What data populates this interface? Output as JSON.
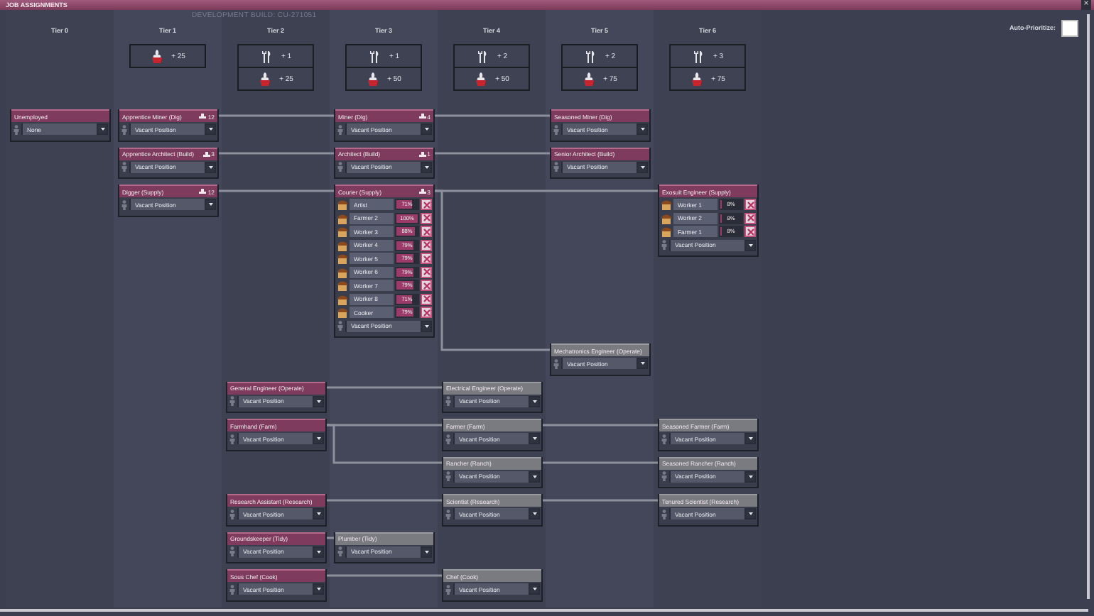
{
  "window": {
    "title": "JOB ASSIGNMENTS",
    "close_glyph": "×"
  },
  "build_label": "DEVELOPMENT BUILD: CU-271051",
  "auto_prioritize": {
    "label": "Auto-Prioritize:",
    "checked": false
  },
  "tiers": [
    {
      "label": "Tier 0"
    },
    {
      "label": "Tier 1",
      "bonuses": [
        {
          "kind": "plant",
          "text": "+ 25"
        }
      ]
    },
    {
      "label": "Tier 2",
      "bonuses": [
        {
          "kind": "tools",
          "text": "+ 1"
        },
        {
          "kind": "plant",
          "text": "+ 25"
        }
      ]
    },
    {
      "label": "Tier 3",
      "bonuses": [
        {
          "kind": "tools",
          "text": "+ 1"
        },
        {
          "kind": "plant",
          "text": "+ 50"
        }
      ]
    },
    {
      "label": "Tier 4",
      "bonuses": [
        {
          "kind": "tools",
          "text": "+ 2"
        },
        {
          "kind": "plant",
          "text": "+ 50"
        }
      ]
    },
    {
      "label": "Tier 5",
      "bonuses": [
        {
          "kind": "tools",
          "text": "+ 2"
        },
        {
          "kind": "plant",
          "text": "+ 75"
        }
      ]
    },
    {
      "label": "Tier 6",
      "bonuses": [
        {
          "kind": "tools",
          "text": "+ 3"
        },
        {
          "kind": "plant",
          "text": "+ 75"
        }
      ]
    }
  ],
  "rows": [
    {
      "tier_0": {
        "title": "Unemployed",
        "unlocked": true,
        "assignment": "None"
      },
      "tier_1": {
        "title": "Apprentice Miner (Dig)",
        "unlocked": true,
        "count": "12",
        "assignment": "Vacant Position"
      },
      "tier_3": {
        "title": "Miner (Dig)",
        "unlocked": true,
        "count": "4",
        "linked": true,
        "assignment": "Vacant Position"
      },
      "tier_5": {
        "title": "Seasoned Miner (Dig)",
        "unlocked": true,
        "linked": true,
        "assignment": "Vacant Position"
      }
    },
    {
      "tier_1": {
        "title": "Apprentice Architect (Build)",
        "unlocked": true,
        "count": "3",
        "assignment": "Vacant Position"
      },
      "tier_3": {
        "title": "Architect (Build)",
        "unlocked": true,
        "count": "1",
        "linked": true,
        "assignment": "Vacant Position"
      },
      "tier_5": {
        "title": "Senior Architect (Build)",
        "unlocked": true,
        "linked": true,
        "assignment": "Vacant Position"
      }
    },
    {
      "tier_1": {
        "title": "Digger (Supply)",
        "unlocked": true,
        "count": "12",
        "assignment": "Vacant Position"
      },
      "tier_3": {
        "title": "Courier (Supply)",
        "unlocked": true,
        "count": "3",
        "linked": true,
        "assignment": "Vacant Position",
        "workers": [
          {
            "name": "Artist",
            "percent": "71%",
            "level": 0.71
          },
          {
            "name": "Farmer 2",
            "percent": "100%",
            "level": 1
          },
          {
            "name": "Worker 3",
            "percent": "88%",
            "level": 0.88
          },
          {
            "name": "Worker 4",
            "percent": "79%",
            "level": 0.79
          },
          {
            "name": "Worker 5",
            "percent": "79%",
            "level": 0.79
          },
          {
            "name": "Worker 6",
            "percent": "79%",
            "level": 0.79
          },
          {
            "name": "Worker 7",
            "percent": "79%",
            "level": 0.79
          },
          {
            "name": "Worker 8",
            "percent": "71%",
            "level": 0.71
          },
          {
            "name": "Cooker",
            "percent": "79%",
            "level": 0.79
          }
        ]
      },
      "tier_6": {
        "title": "Exosuit Engineer (Supply)",
        "unlocked": true,
        "linked": true,
        "assignment": "Vacant Position",
        "workers": [
          {
            "name": "Worker 1",
            "percent": "8%",
            "level": 0.08
          },
          {
            "name": "Worker 2",
            "percent": "8%",
            "level": 0.08
          },
          {
            "name": "Farmer 1",
            "percent": "8%",
            "level": 0.08
          }
        ]
      }
    },
    {
      "tier_5": {
        "title": "Mechatronics Engineer (Operate)",
        "unlocked": false,
        "branch_from_above": true,
        "assignment": "Vacant Position"
      }
    },
    {
      "tier_2": {
        "title": "General Engineer (Operate)",
        "unlocked": true,
        "assignment": "Vacant Position"
      },
      "tier_4": {
        "title": "Electrical Engineer (Operate)",
        "unlocked": false,
        "linked": true,
        "assignment": "Vacant Position"
      }
    },
    {
      "tier_2": {
        "title": "Farmhand (Farm)",
        "unlocked": true,
        "assignment": "Vacant Position"
      },
      "tier_4": {
        "title": "Farmer (Farm)",
        "unlocked": false,
        "linked": true,
        "assignment": "Vacant Position"
      },
      "tier_6": {
        "title": "Seasoned Farmer (Farm)",
        "unlocked": false,
        "linked": true,
        "assignment": "Vacant Position"
      }
    },
    {
      "tier_4": {
        "title": "Rancher (Ranch)",
        "unlocked": false,
        "branch_from_above": true,
        "assignment": "Vacant Position"
      },
      "tier_6": {
        "title": "Seasoned Rancher (Ranch)",
        "unlocked": false,
        "linked": true,
        "assignment": "Vacant Position"
      }
    },
    {
      "tier_2": {
        "title": "Research Assistant (Research)",
        "unlocked": true,
        "assignment": "Vacant Position"
      },
      "tier_4": {
        "title": "Scientist (Research)",
        "unlocked": false,
        "linked": true,
        "assignment": "Vacant Position"
      },
      "tier_6": {
        "title": "Tenured Scientist (Research)",
        "unlocked": false,
        "linked": true,
        "assignment": "Vacant Position"
      }
    },
    {
      "tier_2": {
        "title": "Groundskeeper (Tidy)",
        "unlocked": true,
        "assignment": "Vacant Position"
      },
      "tier_3": {
        "title": "Plumber (Tidy)",
        "unlocked": false,
        "linked": true,
        "assignment": "Vacant Position"
      }
    },
    {
      "tier_2": {
        "title": "Sous Chef (Cook)",
        "unlocked": true,
        "assignment": "Vacant Position"
      },
      "tier_4": {
        "title": "Chef (Cook)",
        "unlocked": false,
        "linked": true,
        "assignment": "Vacant Position"
      }
    }
  ]
}
